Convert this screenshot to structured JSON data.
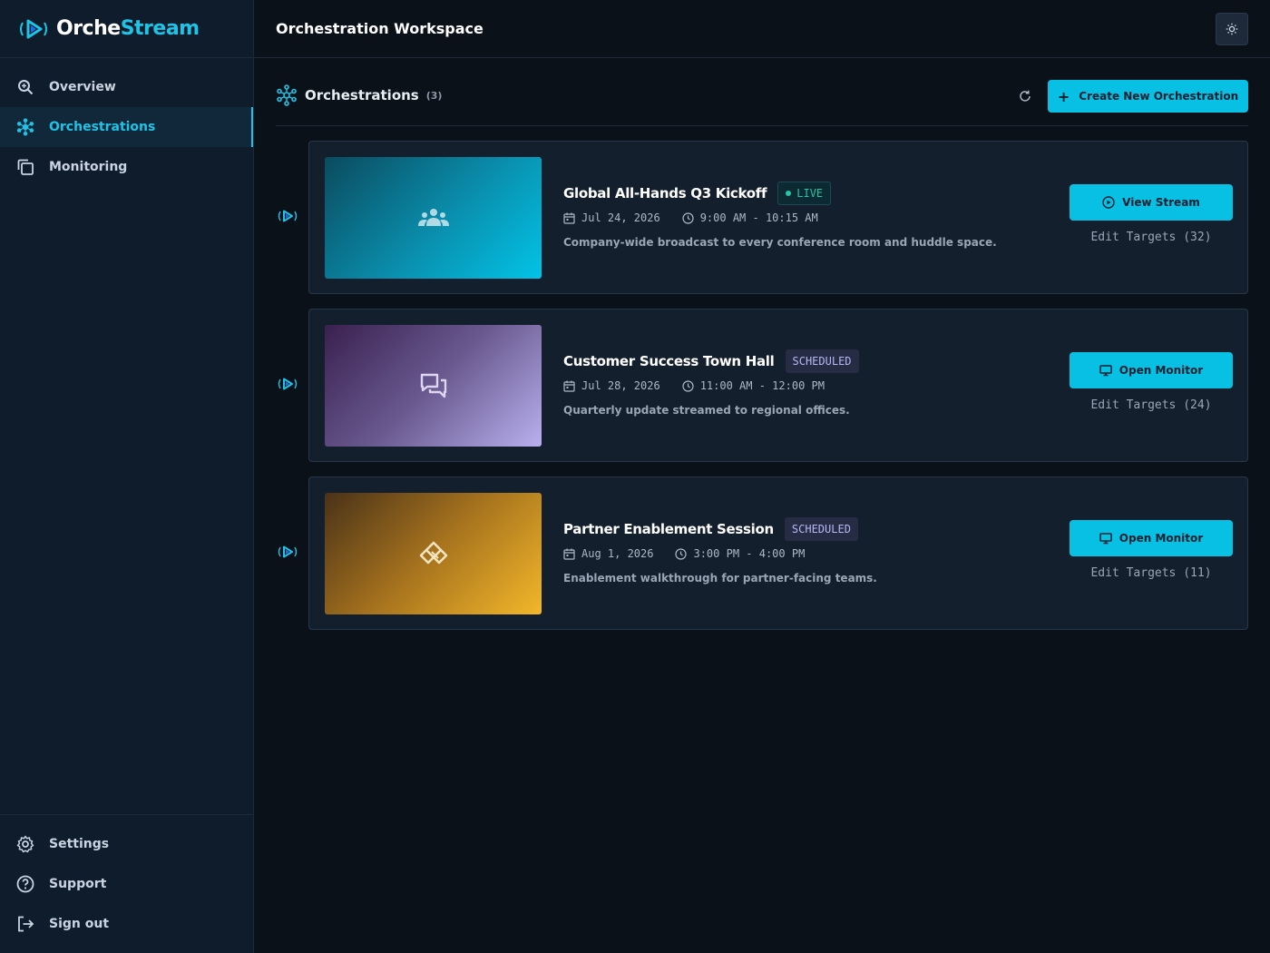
{
  "app": {
    "logo_part1": "Orche",
    "logo_part2": "Stream"
  },
  "sidebar": {
    "items": [
      {
        "label": "Overview",
        "icon": "search-icon"
      },
      {
        "label": "Orchestrations",
        "icon": "network-icon",
        "active": true
      },
      {
        "label": "Monitoring",
        "icon": "copy-icon"
      }
    ],
    "bottom_items": [
      {
        "label": "Settings",
        "icon": "gear-icon"
      },
      {
        "label": "Support",
        "icon": "help-icon"
      },
      {
        "label": "Sign out",
        "icon": "logout-icon"
      }
    ]
  },
  "header": {
    "title": "Orchestration Workspace",
    "theme_icon": "sun-icon"
  },
  "section": {
    "title": "Orchestrations",
    "count": "(3)",
    "create_label": "Create New Orchestration"
  },
  "events": [
    {
      "title": "Global All-Hands Q3 Kickoff",
      "status": "LIVE",
      "date": "Jul 24, 2026",
      "time": "9:00 AM - 10:15 AM",
      "description": "Company-wide broadcast to every conference room and huddle space.",
      "action_label": "View Stream",
      "action_icon": "play-circle-icon",
      "edit_label": "Edit Targets (32)",
      "thumb_icon": "group-icon"
    },
    {
      "title": "Customer Success Town Hall",
      "status": "SCHEDULED",
      "date": "Jul 28, 2026",
      "time": "11:00 AM - 12:00 PM",
      "description": "Quarterly update streamed to regional offices.",
      "action_label": "Open Monitor",
      "action_icon": "monitor-icon",
      "edit_label": "Edit Targets (24)",
      "thumb_icon": "chat-icon"
    },
    {
      "title": "Partner Enablement Session",
      "status": "SCHEDULED",
      "date": "Aug 1, 2026",
      "time": "3:00 PM - 4:00 PM",
      "description": "Enablement walkthrough for partner-facing teams.",
      "action_label": "Open Monitor",
      "action_icon": "monitor-icon",
      "edit_label": "Edit Targets (11)",
      "thumb_icon": "handshake-icon"
    }
  ],
  "colors": {
    "accent": "#08c0e3",
    "live": "#22c6a8",
    "scheduled": "#b3b8f2"
  }
}
